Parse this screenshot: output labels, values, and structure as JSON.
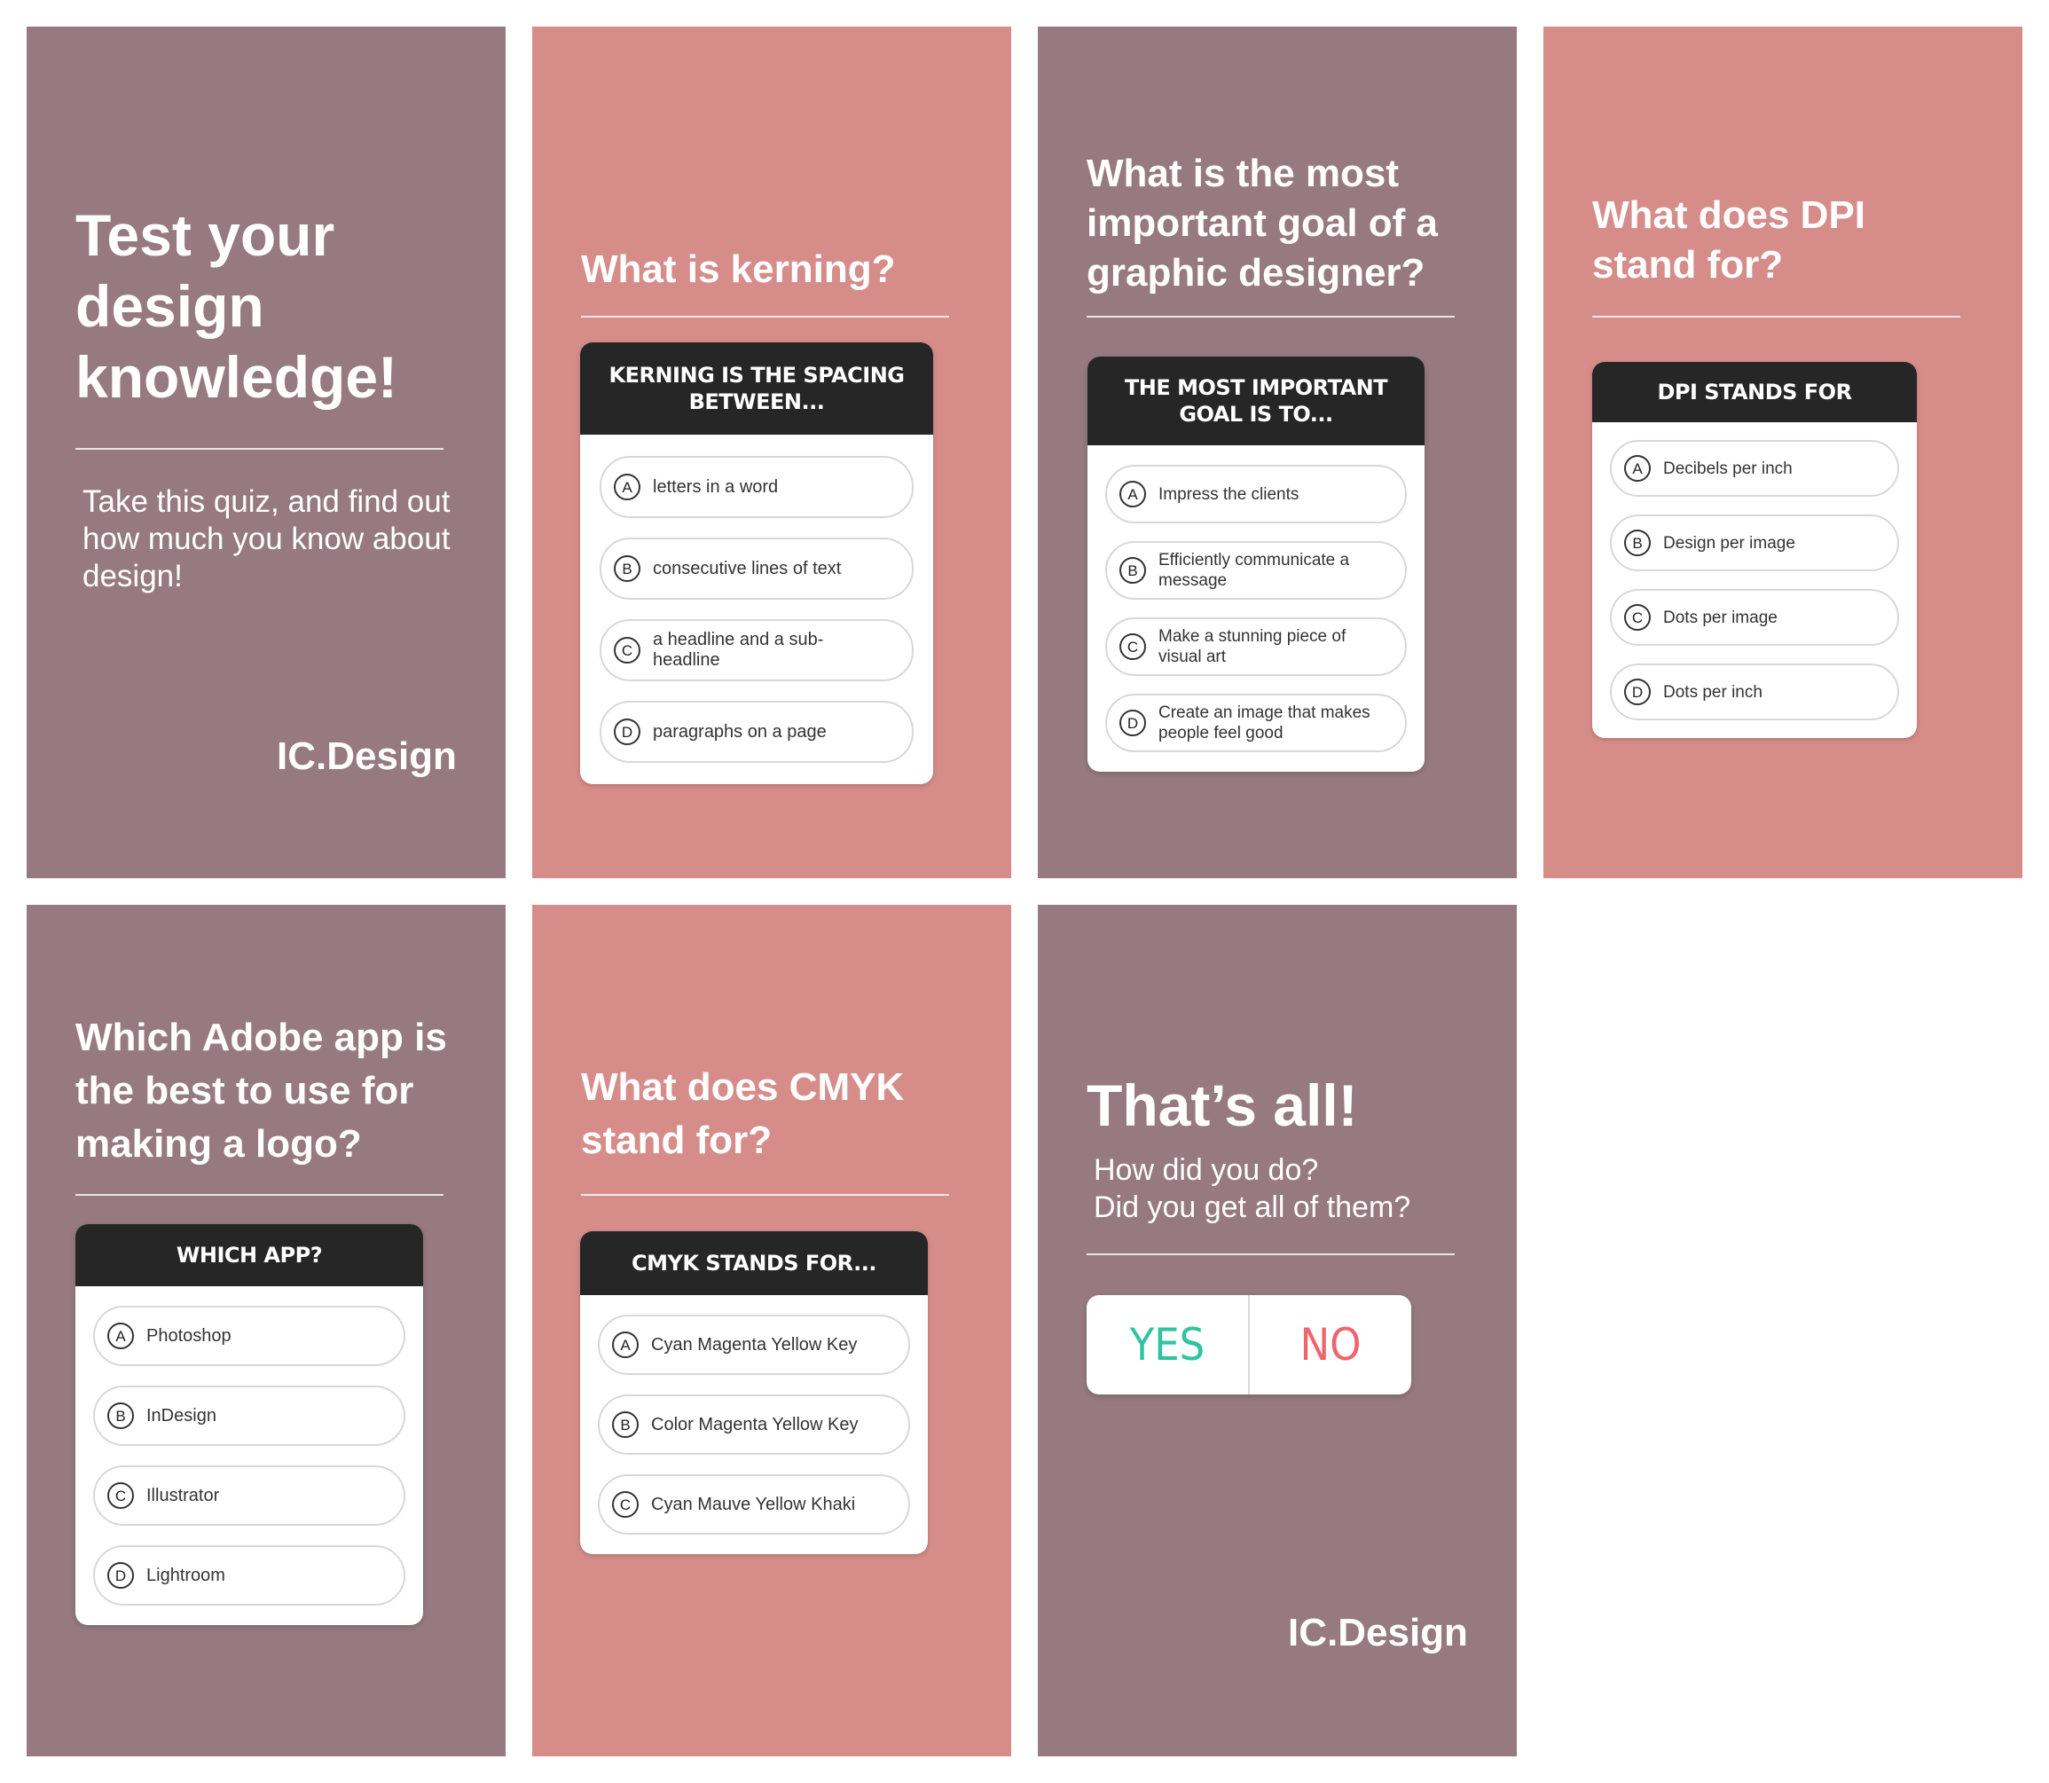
{
  "panels": {
    "intro": {
      "title": "Test your design knowledge!",
      "subtitle": "Take this quiz, and find out how much you know about design!",
      "brand": "IC.Design",
      "bg": "#967981"
    },
    "kerning": {
      "question": "What is kerning?",
      "card_header": "Kerning is the spacing between...",
      "options": [
        {
          "letter": "A",
          "text": "letters in a word"
        },
        {
          "letter": "B",
          "text": "consecutive lines of text"
        },
        {
          "letter": "C",
          "text": "a headline and a sub-headline"
        },
        {
          "letter": "D",
          "text": "paragraphs on a page"
        }
      ],
      "bg": "#d68d8a"
    },
    "goal": {
      "question": "What is the most important goal of a graphic designer?",
      "card_header": "The most important goal is to...",
      "options": [
        {
          "letter": "A",
          "text": "Impress the clients"
        },
        {
          "letter": "B",
          "text": "Efficiently communicate a message"
        },
        {
          "letter": "C",
          "text": "Make a stunning piece of visual art"
        },
        {
          "letter": "D",
          "text": "Create an image that makes people feel good"
        }
      ],
      "bg": "#967981"
    },
    "dpi": {
      "question": "What does DPI stand for?",
      "card_header": "DPI stands for",
      "options": [
        {
          "letter": "A",
          "text": "Decibels per inch"
        },
        {
          "letter": "B",
          "text": "Design per image"
        },
        {
          "letter": "C",
          "text": "Dots per image"
        },
        {
          "letter": "D",
          "text": "Dots per inch"
        }
      ],
      "bg": "#d68d8a"
    },
    "adobe": {
      "question": "Which Adobe app is the best to use for making a logo?",
      "card_header": "Which app?",
      "options": [
        {
          "letter": "A",
          "text": "Photoshop"
        },
        {
          "letter": "B",
          "text": "InDesign"
        },
        {
          "letter": "C",
          "text": "Illustrator"
        },
        {
          "letter": "D",
          "text": "Lightroom"
        }
      ],
      "bg": "#967981"
    },
    "cmyk": {
      "question": "What does CMYK stand for?",
      "card_header": "CMYK stands for...",
      "options": [
        {
          "letter": "A",
          "text": "Cyan Magenta Yellow Key"
        },
        {
          "letter": "B",
          "text": "Color Magenta Yellow Key"
        },
        {
          "letter": "C",
          "text": "Cyan Mauve Yellow Khaki"
        }
      ],
      "bg": "#d68d8a"
    },
    "outro": {
      "title": "That’s all!",
      "subtitle_line1": "How did you do?",
      "subtitle_line2": "Did you get all of them?",
      "yes_label": "YES",
      "no_label": "NO",
      "yes_color": "#2ec4a0",
      "no_color": "#f0646e",
      "brand": "IC.Design",
      "bg": "#967981"
    }
  }
}
